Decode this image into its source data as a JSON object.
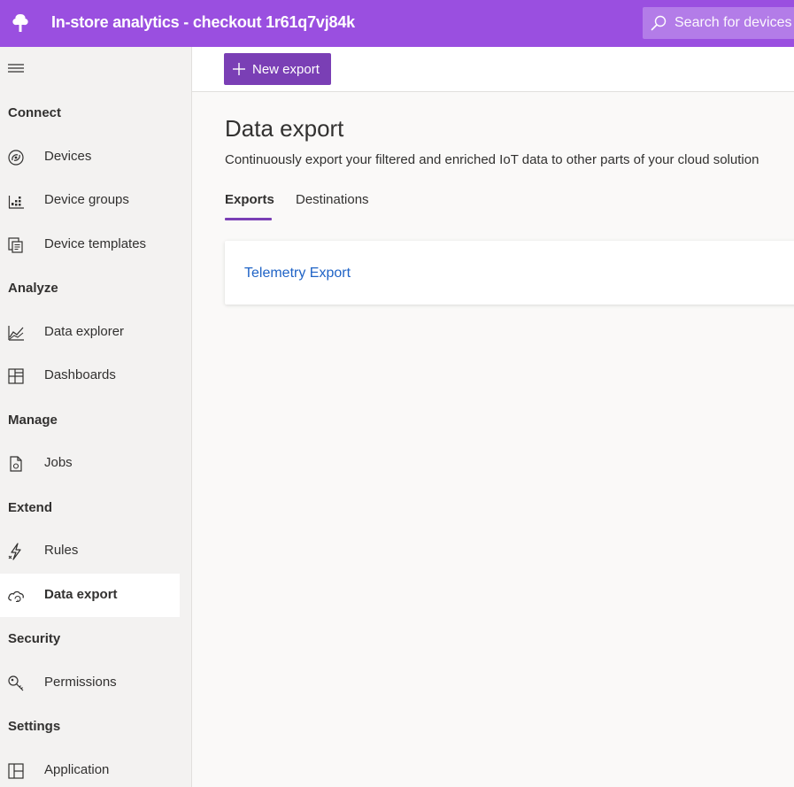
{
  "header": {
    "app_title": "In-store analytics - checkout 1r61q7vj84k",
    "search_placeholder": "Search for devices"
  },
  "sidebar": {
    "sections": [
      {
        "title": "Connect",
        "items": [
          {
            "label": "Devices",
            "icon": "devices-icon"
          },
          {
            "label": "Device groups",
            "icon": "device-groups-icon"
          },
          {
            "label": "Device templates",
            "icon": "device-templates-icon"
          }
        ]
      },
      {
        "title": "Analyze",
        "items": [
          {
            "label": "Data explorer",
            "icon": "data-explorer-icon"
          },
          {
            "label": "Dashboards",
            "icon": "dashboards-icon"
          }
        ]
      },
      {
        "title": "Manage",
        "items": [
          {
            "label": "Jobs",
            "icon": "jobs-icon"
          }
        ]
      },
      {
        "title": "Extend",
        "items": [
          {
            "label": "Rules",
            "icon": "rules-icon"
          },
          {
            "label": "Data export",
            "icon": "data-export-icon",
            "active": true
          }
        ]
      },
      {
        "title": "Security",
        "items": [
          {
            "label": "Permissions",
            "icon": "permissions-icon"
          }
        ]
      },
      {
        "title": "Settings",
        "items": [
          {
            "label": "Application",
            "icon": "application-icon"
          }
        ]
      }
    ]
  },
  "commandbar": {
    "new_export_label": "New export"
  },
  "main": {
    "title": "Data export",
    "description": "Continuously export your filtered and enriched IoT data to other parts of your cloud solution",
    "tabs": [
      {
        "label": "Exports",
        "selected": true
      },
      {
        "label": "Destinations",
        "selected": false
      }
    ],
    "exports": [
      {
        "name": "Telemetry Export"
      }
    ]
  },
  "colors": {
    "header_bg": "#9a4fe0",
    "search_bg": "#b37ce8",
    "accent": "#7a3fb5",
    "link": "#1f63c6",
    "sidebar_bg": "#f3f2f1",
    "page_bg": "#faf9f8"
  }
}
